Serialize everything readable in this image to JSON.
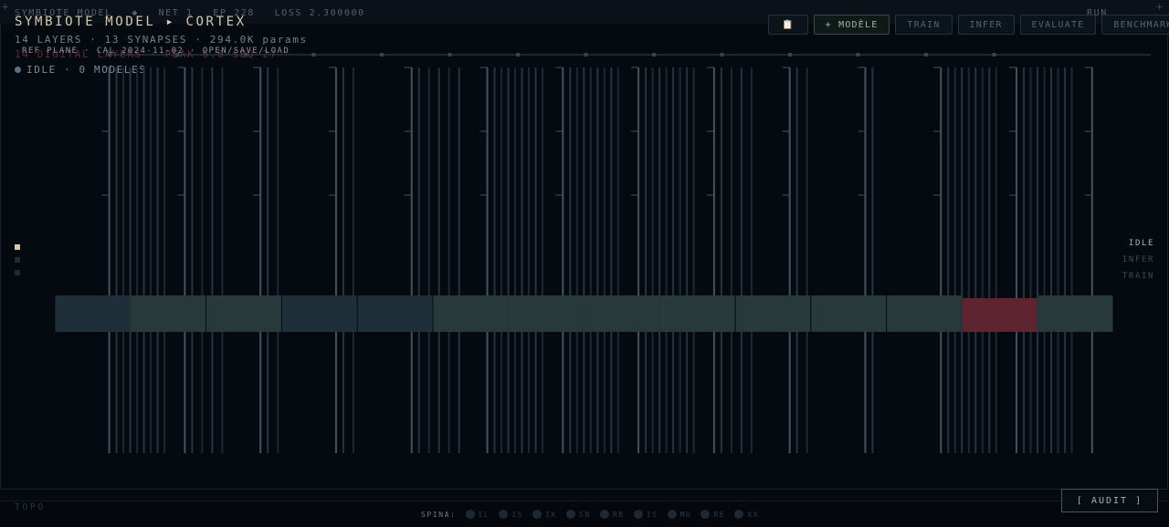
{
  "status_line": {
    "model": "SYMBIOTE MODEL",
    "sep": "◆",
    "net": "NET 1",
    "epoch": "EP 228",
    "loss": "LOSS 2.300000",
    "run": "RUN"
  },
  "header": {
    "title": "SYMBIOTE MODEL ▸ CORTEX",
    "stats": "14 LAYERS · 13 SYNAPSES · 294.0K params",
    "stats_ghost": "14 DIGITAL LAYERS · PEAK 6.0 SEQ 27",
    "ref_line": "REF PLANE · CAL 2024-11-02 · OPEN/SAVE/LOAD",
    "idle": "IDLE · 0 MODELES"
  },
  "toolbar": {
    "icon_label": "📋",
    "new_label": "+ MODÈLE",
    "train_label": "TRAIN",
    "infer_label": "INFER",
    "evaluate_label": "EVALUATE",
    "benchmark_label": "BENCHMARK"
  },
  "modes": [
    "IDLE",
    "INFER",
    "TRAIN"
  ],
  "active_mode": "IDLE",
  "layers": [
    {
      "type": "input",
      "color": "#1e2f3a",
      "density": 10
    },
    {
      "type": "dense",
      "color": "#27393a",
      "density": 4
    },
    {
      "type": "dense",
      "color": "#27393a",
      "density": 2
    },
    {
      "type": "norm",
      "color": "#1e2f3a",
      "density": 2
    },
    {
      "type": "norm",
      "color": "#1e2f3a",
      "density": 5
    },
    {
      "type": "dense",
      "color": "#27393a",
      "density": 8
    },
    {
      "type": "dense",
      "color": "#27393a",
      "density": 9
    },
    {
      "type": "dense",
      "color": "#27393a",
      "density": 9
    },
    {
      "type": "dense",
      "color": "#27393a",
      "density": 4
    },
    {
      "type": "dense",
      "color": "#27393a",
      "density": 2
    },
    {
      "type": "dense",
      "color": "#27393a",
      "density": 1
    },
    {
      "type": "dense",
      "color": "#27393a",
      "density": 8
    },
    {
      "type": "alert",
      "color": "#5e2530",
      "density": 10
    },
    {
      "type": "output",
      "color": "#27393a",
      "density": 0
    }
  ],
  "bottom": {
    "topo": "TOPO",
    "spina_label": "SPINA:",
    "spina_segments": [
      "IL",
      "IS",
      "IK",
      "SB",
      "RB",
      "IS",
      "MU",
      "RE",
      "XX"
    ],
    "audit_label": "[ AUDIT ]"
  }
}
